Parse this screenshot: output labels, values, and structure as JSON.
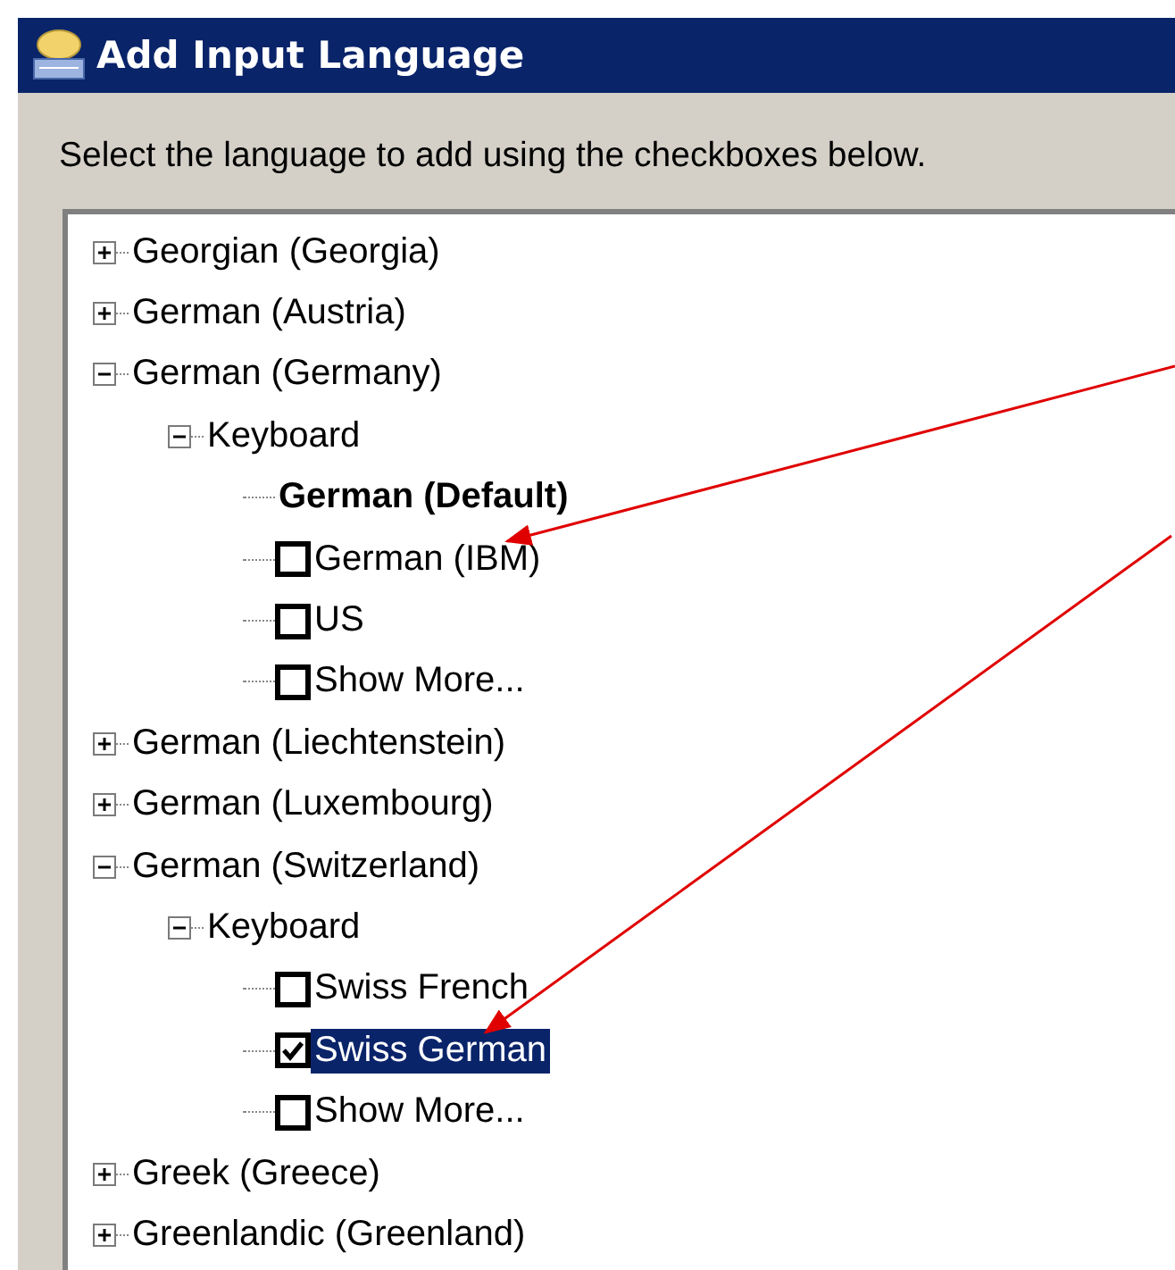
{
  "window": {
    "title": "Add Input Language"
  },
  "instruction": "Select the language to add using the checkboxes below.",
  "tree": [
    {
      "label": "Georgian (Georgia)",
      "expanded": false
    },
    {
      "label": "German (Austria)",
      "expanded": false
    },
    {
      "label": "German (Germany)",
      "expanded": true,
      "children": [
        {
          "label": "Keyboard",
          "expanded": true,
          "children": [
            {
              "kind": "default",
              "label": "German (Default)"
            },
            {
              "kind": "checkbox",
              "label": "German (IBM)",
              "checked": false,
              "selected": false
            },
            {
              "kind": "checkbox",
              "label": "US",
              "checked": false,
              "selected": false
            },
            {
              "kind": "checkbox",
              "label": "Show More...",
              "checked": false,
              "selected": false
            }
          ]
        }
      ]
    },
    {
      "label": "German (Liechtenstein)",
      "expanded": false
    },
    {
      "label": "German (Luxembourg)",
      "expanded": false
    },
    {
      "label": "German (Switzerland)",
      "expanded": true,
      "children": [
        {
          "label": "Keyboard",
          "expanded": true,
          "children": [
            {
              "kind": "checkbox",
              "label": "Swiss French",
              "checked": false,
              "selected": false
            },
            {
              "kind": "checkbox",
              "label": "Swiss German",
              "checked": true,
              "selected": true
            },
            {
              "kind": "checkbox",
              "label": "Show More...",
              "checked": false,
              "selected": false
            }
          ]
        }
      ]
    },
    {
      "label": "Greek (Greece)",
      "expanded": false
    },
    {
      "label": "Greenlandic (Greenland)",
      "expanded": false
    }
  ]
}
